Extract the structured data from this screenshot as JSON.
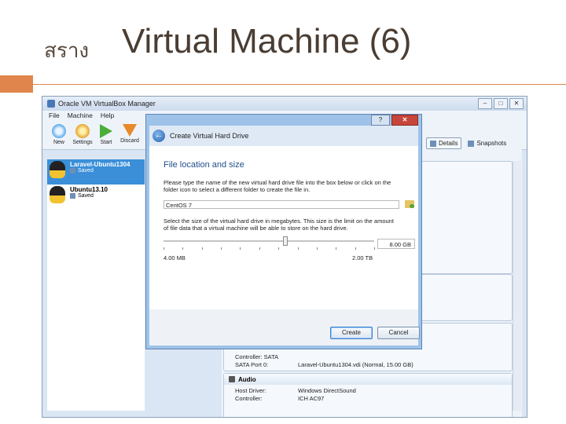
{
  "slide": {
    "title_prefix": "สราง",
    "title": "Virtual Machine (6)",
    "accent_color": "#e0864c"
  },
  "vbox": {
    "window_title": "Oracle VM VirtualBox Manager",
    "window_controls": [
      "–",
      "□",
      "✕"
    ],
    "menu": [
      "File",
      "Machine",
      "Help"
    ],
    "toolbar": {
      "new": "New",
      "settings": "Settings",
      "start": "Start",
      "discard": "Discard"
    },
    "vms": [
      {
        "name": "Laravel-Ubuntu1304",
        "state": "Saved",
        "selected": true
      },
      {
        "name": "Ubuntu13.10",
        "state": "Saved",
        "selected": false
      }
    ],
    "tabs": {
      "details": "Details",
      "snapshots": "Snapshots"
    },
    "storage": {
      "controller_label": "Controller: SATA",
      "port_key": "SATA Port 0:",
      "port_value": "Laravel-Ubuntu1304.vdi (Normal, 15.00 GB)"
    },
    "audio": {
      "heading": "Audio",
      "host_driver_key": "Host Driver:",
      "host_driver_value": "Windows DirectSound",
      "controller_key": "Controller:",
      "controller_value": "ICH AC97"
    }
  },
  "dialog": {
    "title": "Create Virtual Hard Drive",
    "help_button": "?",
    "close_button": "✕",
    "heading": "File location and size",
    "location_text": "Please type the name of the new virtual hard drive file into the box below or click on the folder icon to select a different folder to create the file in.",
    "file_name": "CentOS 7",
    "size_text": "Select the size of the virtual hard drive in megabytes. This size is the limit on the amount of file data that a virtual machine will be able to store on the hard drive.",
    "size_value": "8.00 GB",
    "size_position_fraction": 0.58,
    "range_min": "4.00 MB",
    "range_max": "2.00 TB",
    "create_button": "Create",
    "cancel_button": "Cancel"
  }
}
